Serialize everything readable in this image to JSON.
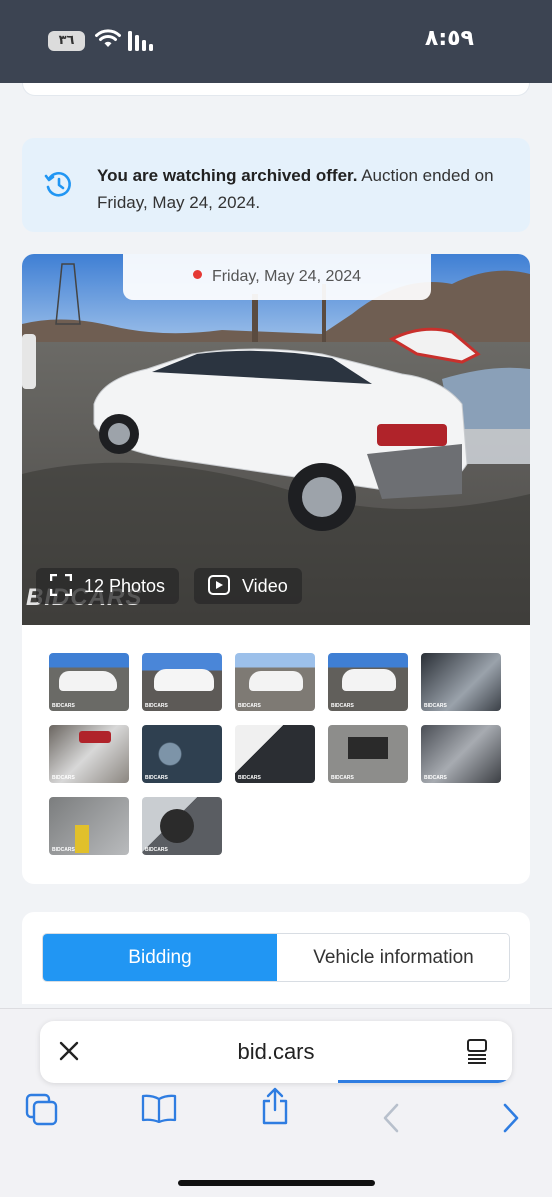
{
  "status_bar": {
    "time": "٨:٥٩",
    "battery": "٣٦"
  },
  "archived_notice": {
    "bold": "You are watching archived offer.",
    "text": " Auction ended on Friday, May 24, 2024."
  },
  "gallery": {
    "date": "Friday, May 24, 2024",
    "photos_label": "12 Photos",
    "video_label": "Video",
    "watermark": "BIDCARS",
    "thumb_label": "BIDCARS"
  },
  "tabs": {
    "bidding": "Bidding",
    "vehicle_info": "Vehicle information"
  },
  "browser": {
    "url": "bid.cars"
  },
  "colors": {
    "accent": "#2196f3",
    "status_bar": "#3c4452",
    "notice_bg": "#e5f1fb",
    "link_blue": "#2f7de1"
  }
}
